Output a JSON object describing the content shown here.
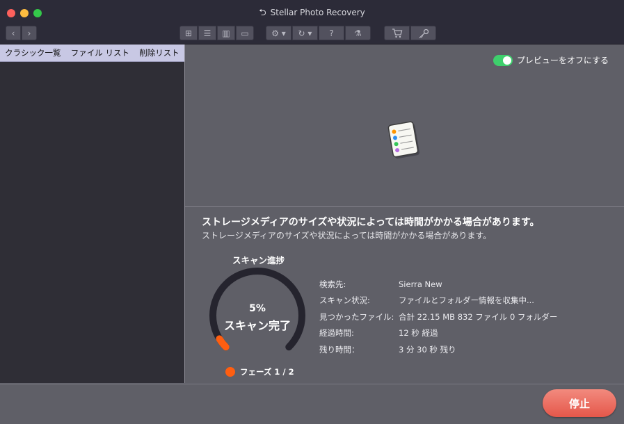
{
  "window": {
    "title": "Stellar Photo Recovery",
    "back_glyph": "⮌"
  },
  "toolbar": {
    "nav_back": "‹",
    "nav_forward": "›",
    "views": [
      "⊞",
      "☰",
      "▥",
      "▭"
    ],
    "settings_glyph": "⚙ ▾",
    "history_glyph": "↻ ▾",
    "help_glyph": "?",
    "analyze_glyph": "⚗",
    "cart_glyph": "🛒",
    "key_glyph": "🔑"
  },
  "sidebar": {
    "tabs": [
      "クラシック一覧",
      "ファイル リスト",
      "削除リスト"
    ]
  },
  "preview": {
    "toggle_label": "プレビューをオフにする",
    "toggle_on": true
  },
  "messages": {
    "primary": "ストレージメディアのサイズや状況によっては時間がかかる場合があります。",
    "secondary": "ストレージメディアのサイズや状況によっては時間がかかる場合があります。"
  },
  "scan": {
    "title": "スキャン進捗",
    "percent": "5%",
    "percent_value": 0.05,
    "status_label": "スキャン完了",
    "phase": "フェーズ 1 / 2",
    "accent_color": "#ff5e10",
    "track_color": "#25242e"
  },
  "info": [
    {
      "label": "検索先:",
      "value": "Sierra New"
    },
    {
      "label": "スキャン状況:",
      "value": "ファイルとフォルダー情報を収集中..."
    },
    {
      "label": "見つかったファイル:",
      "value": "合計 22.15 MB 832 ファイル 0 フォルダー"
    },
    {
      "label": "経過時間:",
      "value": "12 秒 経過"
    },
    {
      "label": "残り時間：",
      "value": "3 分 30 秒 残り"
    }
  ],
  "footer": {
    "stop_label": "停止"
  }
}
